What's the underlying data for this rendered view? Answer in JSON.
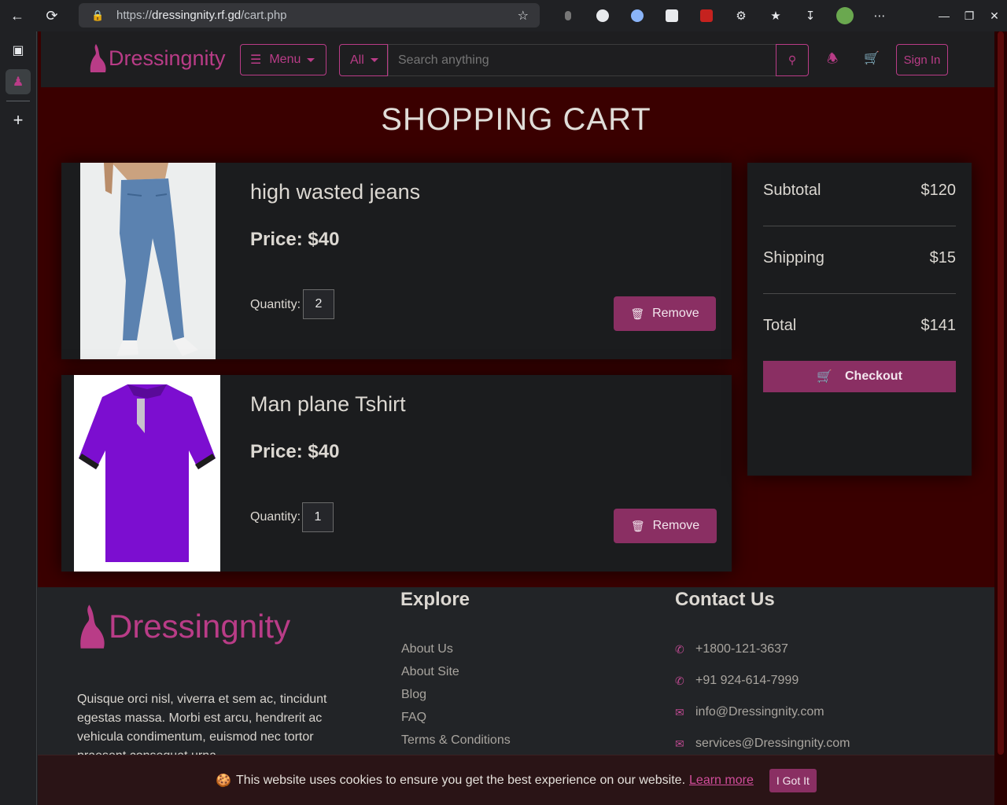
{
  "browser": {
    "url_scheme": "https://",
    "url_host": "dressingnity.rf.gd",
    "url_path": "/cart.php"
  },
  "header": {
    "brand": "Dressingnity",
    "menu_label": "Menu",
    "category_label": "All",
    "search_placeholder": "Search anything",
    "signin_label": "Sign In"
  },
  "page": {
    "title": "SHOPPING CART"
  },
  "cart": {
    "items": [
      {
        "name": "high wasted jeans",
        "price": "Price: $40",
        "qty_label": "Quantity:",
        "qty": "2",
        "remove_label": "Remove"
      },
      {
        "name": "Man plane Tshirt",
        "price": "Price: $40",
        "qty_label": "Quantity:",
        "qty": "1",
        "remove_label": "Remove"
      }
    ]
  },
  "summary": {
    "subtotal_label": "Subtotal",
    "subtotal": "$120",
    "shipping_label": "Shipping",
    "shipping": "$15",
    "total_label": "Total",
    "total": "$141",
    "checkout_label": "Checkout"
  },
  "footer": {
    "brand": "Dressingnity",
    "about_text": "Quisque orci nisl, viverra et sem ac, tincidunt egestas massa. Morbi est arcu, hendrerit ac vehicula condimentum, euismod nec tortor praesent consequat urna",
    "explore_heading": "Explore",
    "explore_links": [
      "About Us",
      "About Site",
      "Blog",
      "FAQ",
      "Terms & Conditions"
    ],
    "contact_heading": "Contact Us",
    "contacts": [
      "+1800-121-3637",
      "+91 924-614-7999",
      "info@Dressingnity.com",
      "services@Dressingnity.com"
    ]
  },
  "cookie": {
    "message": "This website uses cookies to ensure you get the best experience on our website.",
    "learn_more": "Learn more",
    "accept_label": "I Got It"
  },
  "colors": {
    "accent": "#b93c87",
    "button": "#8a2f63",
    "page_bg": "#3a0000",
    "card_bg": "#1b1c1e"
  }
}
